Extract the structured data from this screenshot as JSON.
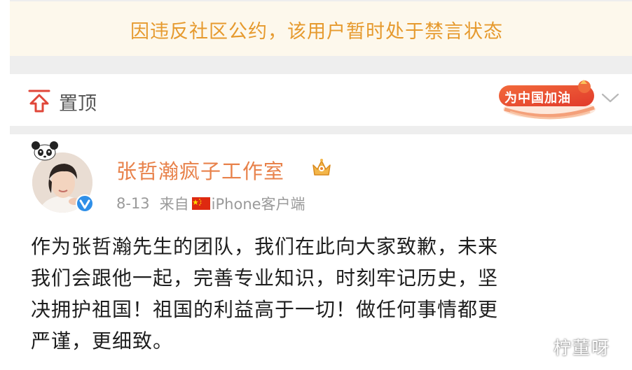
{
  "banner": {
    "text": "因违反社区公约，该用户暂时处于禁言状态",
    "color": "#e69a2e"
  },
  "pinned": {
    "icon": "pin-top-icon",
    "label": "置顶",
    "badge_text": "为中国加油",
    "badge_color": "#e8452c",
    "menu_icon": "chevron-down-icon"
  },
  "post": {
    "author": "张哲瀚疯子工作室",
    "author_color": "#e8824b",
    "member_icon": "crown-icon",
    "verified_icon": "verified-icon",
    "date": "8-13",
    "source_prefix": "来自",
    "flag_icon": "china-flag-icon",
    "source": "iPhone客户端",
    "body_lines": [
      "作为张哲瀚先生的团队，我们在此向大家致歉，未来",
      "我们会跟他一起，完善专业知识，时刻牢记历史，坚",
      "决拥护祖国！祖国的利益高于一切！做任何事情都更",
      "严谨，更细致。"
    ]
  },
  "watermark": "柠董呀"
}
